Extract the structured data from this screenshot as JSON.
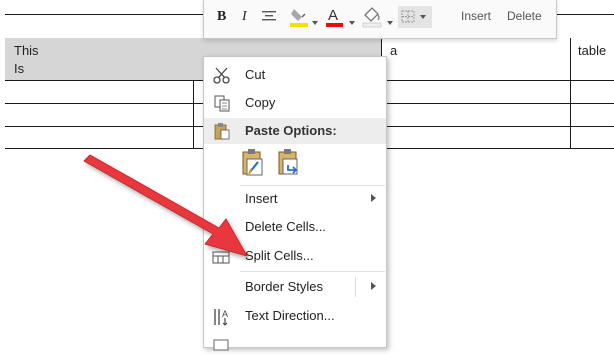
{
  "mini_toolbar": {
    "bold": "B",
    "italic": "I",
    "insert_label": "Insert",
    "delete_label": "Delete"
  },
  "table": {
    "cell_1": "This",
    "cell_1b": "Is",
    "cell_2": "a",
    "cell_3": "table"
  },
  "context_menu": {
    "cut": "Cut",
    "copy": "Copy",
    "paste_options": "Paste Options:",
    "insert": "Insert",
    "delete_cells": "Delete Cells...",
    "split_cells": "Split Cells...",
    "border_styles": "Border Styles",
    "text_direction": "Text Direction..."
  },
  "colors": {
    "highlight_swatch": "#f5e000",
    "font_color_swatch": "#e01010",
    "arrow": "#e8383d",
    "selection": "#d6d6d6"
  }
}
